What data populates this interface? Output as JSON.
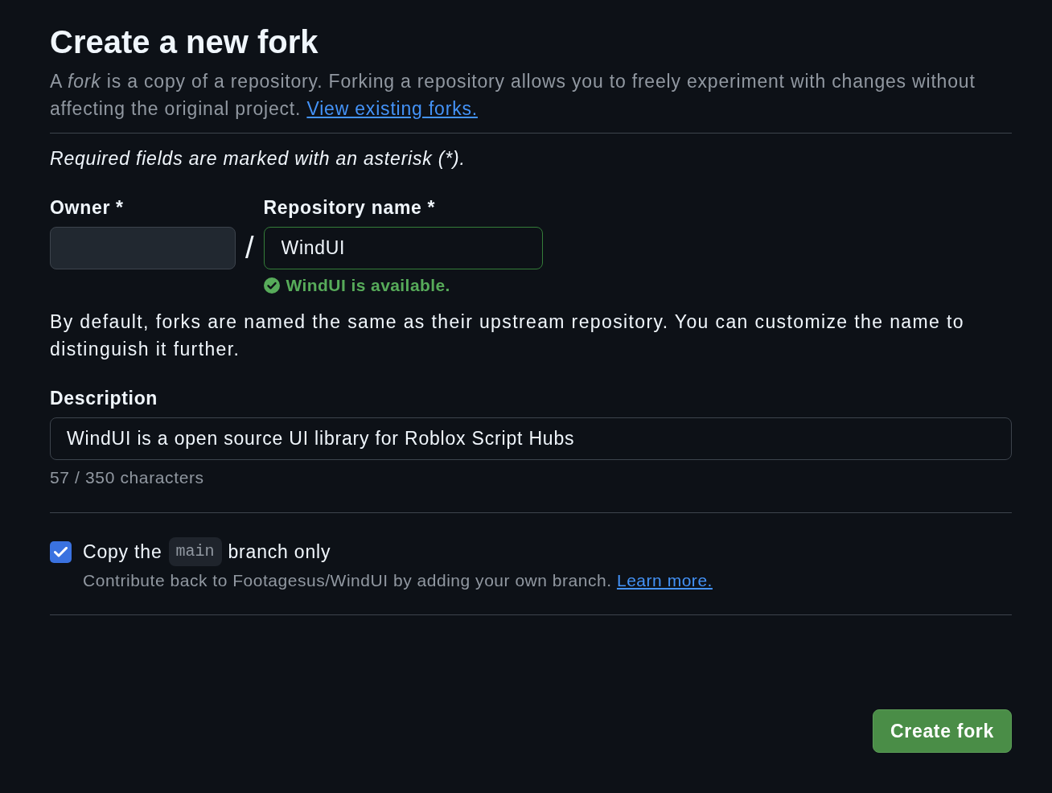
{
  "title": "Create a new fork",
  "intro": "A *fork* is a copy of a repository. Forking a repository allows you to freely experiment with changes without affecting the original project.",
  "intro_link": "View existing forks.",
  "required_note": "Required fields are marked with an asterisk (*).",
  "owner": {
    "label": "Owner *"
  },
  "separator": "/",
  "repository_name": {
    "label": "Repository name *",
    "value": "WindUI",
    "valid": true,
    "validation": "WindUI is available."
  },
  "naming_hint": "By default, forks are named the same as their upstream repository. You can customize the name to distinguish it further.",
  "description": {
    "label": "Description",
    "value": "WindUI is a open source UI library for Roblox Script Hubs",
    "counter": "57 / 350 characters"
  },
  "copy_branch": {
    "checked": true,
    "label_before": "Copy the",
    "branch": "main",
    "label_after": "branch only",
    "hint": "Contribute back to Footagesus/WindUI by adding your own branch.",
    "hint_link": "Learn more."
  },
  "submit_button": "Create fork"
}
